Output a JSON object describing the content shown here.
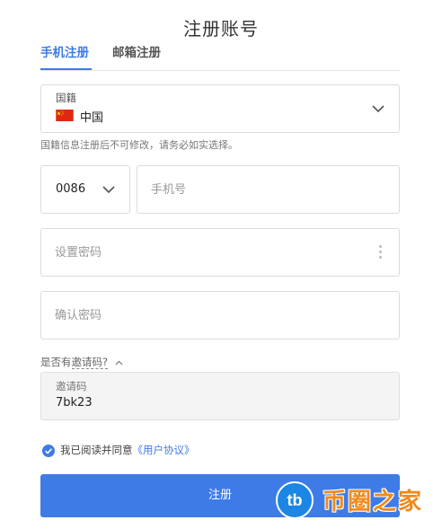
{
  "title": "注册账号",
  "tabs": [
    {
      "label": "手机注册",
      "active": true
    },
    {
      "label": "邮箱注册",
      "active": false
    }
  ],
  "nationality": {
    "label": "国籍",
    "value": "中国",
    "flag_icon": "china-flag-icon",
    "hint": "国籍信息注册后不可修改，请务必如实选择。"
  },
  "phone": {
    "country_code": "0086",
    "placeholder": "手机号"
  },
  "password": {
    "placeholder": "设置密码"
  },
  "confirm_password": {
    "placeholder": "确认密码"
  },
  "invite": {
    "toggle_prefix": "是否有",
    "toggle_link": "邀请码?",
    "label": "邀请码",
    "value": "7bk23"
  },
  "agreement": {
    "text": "我已阅读并同意",
    "link": "《用户协议》",
    "checked": true
  },
  "submit_label": "注册",
  "watermark": {
    "logo": "tb",
    "text": "币圈之家"
  },
  "colors": {
    "accent": "#3e7be6",
    "watermark_orange": "#f08a1c",
    "watermark_blue": "#1b86e3"
  }
}
